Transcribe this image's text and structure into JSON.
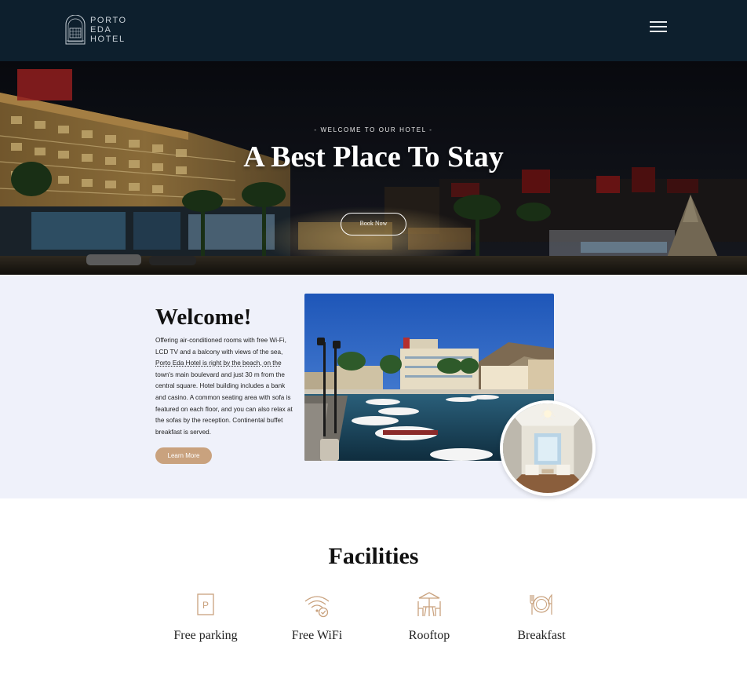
{
  "brand": {
    "line1": "PORTO",
    "line2": "EDA",
    "line3": "HOTEL"
  },
  "nav": {
    "menu_icon": "hamburger-icon"
  },
  "hero": {
    "kicker": "- WELCOME TO OUR HOTEL -",
    "title": "A Best Place To Stay",
    "button_label": "Book Now"
  },
  "welcome": {
    "title": "Welcome!",
    "text_part1": "Offering air-conditioned rooms with free Wi-Fi, LCD TV and a balcony with views of the sea, ",
    "text_link": "Porto Eda Hotel is right by the beach, on the",
    "text_part2": " town's main boulevard and just 30 m from the central square. Hotel building includes a bank and casino. A common seating area with sofa is featured on each floor, and you can also relax at the sofas by the reception. Continental buffet breakfast is served.",
    "button_label": "Learn More"
  },
  "facilities": {
    "title": "Facilities",
    "items": [
      {
        "label": "Free parking",
        "icon": "parking-icon"
      },
      {
        "label": "Free WiFi",
        "icon": "wifi-icon"
      },
      {
        "label": "Rooftop",
        "icon": "rooftop-icon"
      },
      {
        "label": "Breakfast",
        "icon": "breakfast-icon"
      }
    ]
  },
  "colors": {
    "header_bg": "#0d1f2d",
    "welcome_bg": "#eff1fa",
    "accent": "#c9a27e",
    "icon_stroke": "#c9a27e"
  }
}
